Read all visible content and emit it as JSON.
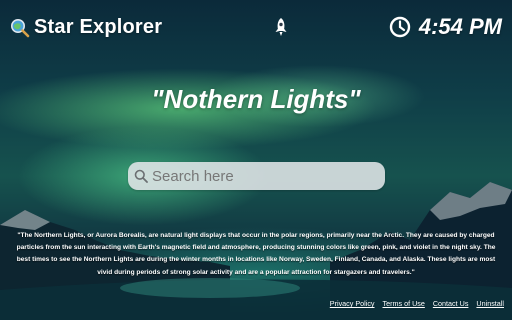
{
  "app": {
    "title": "Star Explorer"
  },
  "clock": {
    "time": "4:54 PM"
  },
  "headline": "\"Nothern Lights\"",
  "search": {
    "placeholder": "Search here",
    "value": ""
  },
  "description": "\"The Northern Lights, or Aurora Borealis, are natural light displays that occur in the polar regions, primarily near the Arctic. They are caused by charged particles from the sun interacting with Earth's magnetic field and atmosphere, producing stunning colors like green, pink, and violet in the night sky. The best times to see the Northern Lights are during the winter months in locations like Norway, Sweden, Finland, Canada, and Alaska. These lights are most vivid during periods of strong solar activity and are a popular attraction for stargazers and travelers.\"",
  "footer": {
    "links": [
      "Privacy Policy",
      "Terms of Use",
      "Contact Us",
      "Uninstall"
    ]
  },
  "icons": {
    "brand": "magnifier-globe-icon",
    "rocket": "rocket-icon",
    "clock": "clock-icon",
    "search": "search-icon"
  },
  "colors": {
    "search_bg": "#e1e6e8",
    "text": "#ffffff"
  }
}
